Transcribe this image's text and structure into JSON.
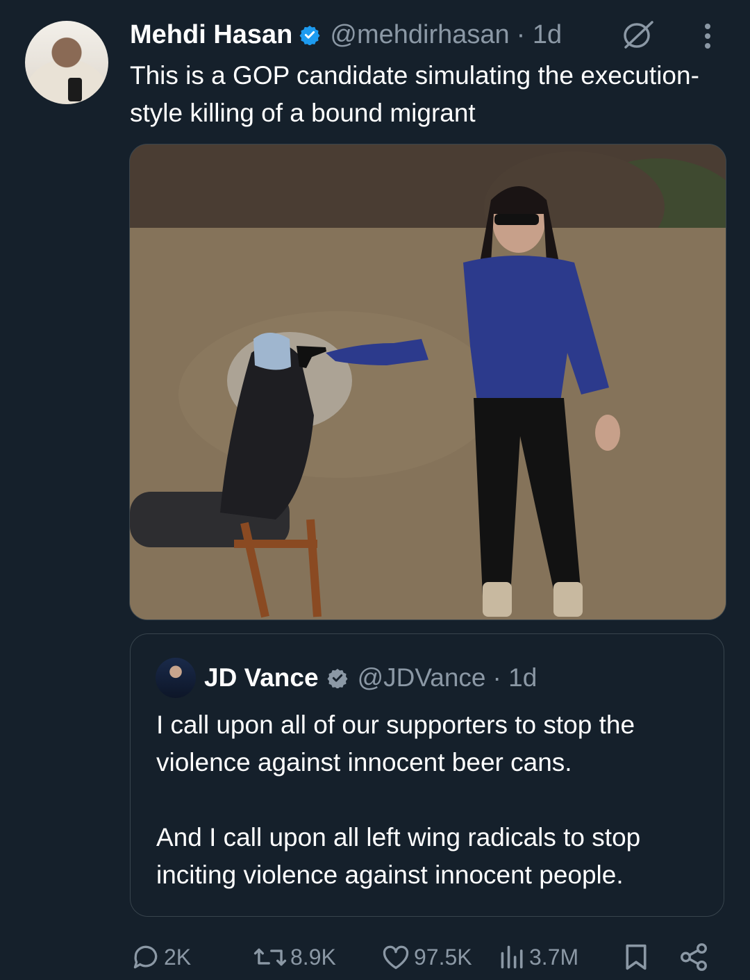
{
  "author": {
    "name": "Mehdi Hasan",
    "handle": "@mehdirhasan",
    "time": "· 1d"
  },
  "tweet": {
    "text": "This is a GOP candidate simulating the execution-style killing of a bound migrant"
  },
  "quoted": {
    "name": "JD Vance",
    "handle": "@JDVance",
    "time": "· 1d",
    "paragraph1": "I call upon all of our supporters to stop the violence against innocent beer cans.",
    "paragraph2": "And I call upon all left wing radicals to stop inciting violence against innocent people."
  },
  "actions": {
    "replies": "2K",
    "retweets": "8.9K",
    "likes": "97.5K",
    "views": "3.7M"
  },
  "icons": [
    "verified-icon",
    "grok-icon",
    "more-icon",
    "reply-icon",
    "retweet-icon",
    "like-icon",
    "views-icon",
    "bookmark-icon",
    "share-icon"
  ],
  "colors": {
    "background": "#15202b",
    "secondary_text": "#8b98a5",
    "verified": "#1d9bf0",
    "border": "#38444d"
  }
}
